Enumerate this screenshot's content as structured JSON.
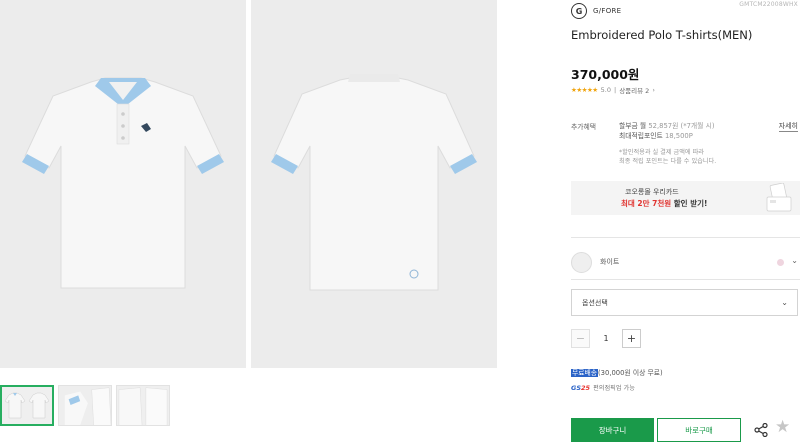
{
  "gallery": {
    "main_images": [
      {
        "name": "polo-front-image",
        "view": "front"
      },
      {
        "name": "polo-back-image",
        "view": "back"
      }
    ],
    "thumbnail_count": 3,
    "active_thumbnail": 0
  },
  "product": {
    "code": "GMTCM22008WHX",
    "brand_logo_text": "G",
    "brand_name": "G/FORE",
    "title": "Embroidered Polo T-shirts(MEN)",
    "price": "370,000원",
    "rating_stars": "★★★★★",
    "rating_value": "5.0",
    "review_label": "상품리뷰 2",
    "review_chevron": "›"
  },
  "benefit": {
    "label": "추가혜택",
    "installment_prefix": "할부금 월 ",
    "installment_amount": "52,857원",
    "installment_suffix": " (*7개월 시)",
    "points_label": "최대적립포인트 ",
    "points_value": "18,500P",
    "note_line1": "*할인적용과 실 결제 금액에 따라",
    "note_line2": "최종 적립 포인트는 다를 수 있습니다.",
    "detail_link": "자세히"
  },
  "card_banner": {
    "line1": "코오롱몰 우리카드",
    "line2_highlight": "최대 2만 7천원",
    "line2_rest": " 할인 받기!"
  },
  "color": {
    "name": "화이트",
    "chevron": "⌄"
  },
  "option": {
    "placeholder": "옵션선택",
    "chevron": "⌄"
  },
  "quantity": {
    "minus": "−",
    "value": "1",
    "plus": "+"
  },
  "shipping": {
    "highlight": "무료배송",
    "rest": "(30,000원 이상 무료)",
    "gs_logo_prefix": "GS",
    "gs_logo_suffix": "25",
    "gs_text": "편의점픽업 가능"
  },
  "actions": {
    "cart": "장바구니",
    "buy": "바로구매",
    "wish": "★"
  },
  "colors": {
    "accent_green": "#1a9a4a",
    "highlight_blue": "#2b63c7",
    "promo_red": "#e0332f",
    "star_orange": "#f0a30a"
  }
}
